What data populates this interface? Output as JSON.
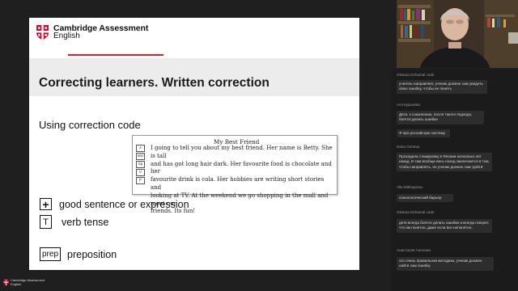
{
  "slide": {
    "brand_line1": "Cambridge Assessment",
    "brand_line2": "English",
    "title": "Correcting learners. Written correction",
    "subtitle": "Using correction code",
    "example": {
      "title": "My Best Friend",
      "codes": [
        "⅄",
        "WO",
        "Sp",
        "V",
        "P"
      ],
      "lines": [
        "I going to tell you about my best friend. Her name is Betty. She is tall",
        "and has got long hair dark. Her favourite food is chocolate and her",
        "favourite drink is cola. Her hobbies are writing short stories and",
        "looking at TV. At the weekend we go shopping in the mall and meet our",
        "friends. Its fun!"
      ]
    },
    "legend": [
      {
        "code": "+",
        "label": "good sentence or expression"
      },
      {
        "code": "T",
        "label": "verb tense"
      },
      {
        "code": "prep",
        "label": "preposition"
      }
    ]
  },
  "chat": {
    "messages": [
      {
        "name": "Oksana Dzhamal code",
        "text": "учитель направляет, ученик должен сам увидеть свою ошибку, чтобы ее понять"
      },
      {
        "name": "Ася Курьяева",
        "text": "Дети, к сожалению, после такого подхода, боятся делать ошибки"
      },
      {
        "name": "",
        "text": "Я про российскую систему"
      },
      {
        "name": "Daria Grineva",
        "text": "Проходила стажировку в Японии несколько лет назад. И там вообще весь поход заключается в том, чтобы направлять, но ученик должен сам 'дойти'"
      },
      {
        "name": "Alla Mikhaylova",
        "text": "психологический барьер"
      },
      {
        "name": "Oksana Dzhamal code",
        "text": "дети всегда боятся делать ошибки и всегда говорят, что им понятно, даже если все непонятно."
      },
      {
        "name": "Анастасия Аносина",
        "text": "это очень правильная методика, ученик должен найти сам ошибку"
      }
    ]
  },
  "footer": {
    "logo_line1": "Cambridge Assessment",
    "logo_line2": "English"
  },
  "colors": {
    "accent_red": "#d4202c",
    "title_band": "#ececec",
    "chat_bg": "#1b1b1b"
  }
}
